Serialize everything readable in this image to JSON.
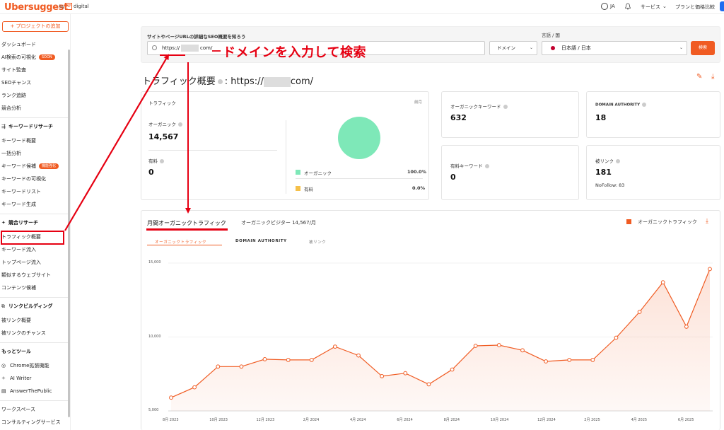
{
  "header": {
    "logo": "Ubersuggest",
    "logo_by": "by",
    "logo_np": "NP",
    "logo_digital": "digital",
    "language": "JA",
    "services": "サービス",
    "pricing": "プランと価格比較"
  },
  "sidebar": {
    "add_project": "+ プロジェクトの追加",
    "group1": [
      {
        "label": "ダッシュボード"
      },
      {
        "label": "AI検索の可視化",
        "badge": "SOON"
      },
      {
        "label": "サイト監査"
      },
      {
        "label": "SEOチャンス"
      },
      {
        "label": "ランク追跡"
      },
      {
        "label": "競合分析"
      }
    ],
    "keyword_research": {
      "heading": "キーワードリサーチ",
      "items": [
        {
          "label": "キーワード概要"
        },
        {
          "label": "一括分析"
        },
        {
          "label": "キーワード候補",
          "badge": "機能強化"
        },
        {
          "label": "キーワードの可視化"
        },
        {
          "label": "キーワードリスト"
        },
        {
          "label": "キーワード生成"
        }
      ]
    },
    "competitive_research": {
      "heading": "競合リサーチ",
      "items": [
        {
          "label": "トラフィック概要"
        },
        {
          "label": "キーワード流入"
        },
        {
          "label": "トップページ流入"
        },
        {
          "label": "類似するウェブサイト"
        },
        {
          "label": "コンテンツ候補"
        }
      ]
    },
    "link_building": {
      "heading": "リンクビルディング",
      "items": [
        {
          "label": "被リンク概要"
        },
        {
          "label": "被リンクのチャンス"
        }
      ]
    },
    "more_tools": {
      "heading": "もっとツール",
      "items": [
        {
          "label": "Chrome拡張機能"
        },
        {
          "label": "AI Writer"
        },
        {
          "label": "AnswerThePublic"
        }
      ]
    },
    "bottom": [
      {
        "label": "ワークスペース"
      },
      {
        "label": "コンサルティングサービス"
      }
    ]
  },
  "search": {
    "label": "サイトやページURLの詳細なSEO概要を知ろう",
    "value_prefix": "https://",
    "value_suffix": "com/",
    "domain_select": "ドメイン",
    "lang_label": "言語 / 国",
    "lang_value": "日本語 / 日本",
    "button": "検索"
  },
  "annotation": {
    "text": "ドメインを入力して検索"
  },
  "overview": {
    "title": "トラフィック概要",
    "title_url_prefix": ": https://",
    "title_url_suffix": "com/"
  },
  "traffic_card": {
    "label": "トラフィック",
    "period": "前月",
    "organic_label": "オーガニック",
    "organic_value": "14,567",
    "paid_label": "有料",
    "paid_value": "0",
    "legend_organic": "オーガニック",
    "legend_organic_pct": "100.0%",
    "legend_paid": "有料",
    "legend_paid_pct": "0.0%",
    "colors": {
      "organic": "#7ee8b8",
      "paid": "#f5c04a"
    }
  },
  "organic_keywords": {
    "label": "オーガニックキーワード",
    "value": "632"
  },
  "domain_authority": {
    "label": "DOMAIN AUTHORITY",
    "value": "18"
  },
  "paid_keywords": {
    "label": "有料キーワード",
    "value": "0"
  },
  "backlinks": {
    "label": "被リンク",
    "value": "181",
    "nofollow": "NoFollow: 83"
  },
  "chart_section": {
    "tab": "月間オーガニックトラフィック",
    "visitors": "オーガニックビジター 14,567/月",
    "legend": "オーガニックトラフィック",
    "subtabs": [
      "オーガニックトラフィック",
      "DOMAIN AUTHORITY",
      "被リンク"
    ]
  },
  "chart_data": {
    "type": "area",
    "x": [
      "2023-08",
      "2023-09",
      "2023-10",
      "2023-11",
      "2023-12",
      "2024-01",
      "2024-02",
      "2024-03",
      "2024-04",
      "2024-05",
      "2024-06",
      "2024-07",
      "2024-08",
      "2024-09",
      "2024-10",
      "2024-11",
      "2024-12",
      "2025-01",
      "2025-02",
      "2025-03",
      "2025-04",
      "2025-05",
      "2025-06",
      "2025-07"
    ],
    "xticks": [
      "8月 2023",
      "10月 2023",
      "12月 2023",
      "2月 2024",
      "4月 2024",
      "6月 2024",
      "8月 2024",
      "10月 2024",
      "12月 2024",
      "2月 2025",
      "4月 2025",
      "6月 2025"
    ],
    "series": [
      {
        "name": "オーガニックトラフィック",
        "values": [
          5900,
          6600,
          8000,
          8000,
          8500,
          8450,
          8450,
          9350,
          8750,
          7350,
          7550,
          6800,
          7800,
          9400,
          9450,
          9100,
          8350,
          8450,
          8450,
          9950,
          11700,
          13700,
          10700,
          14600
        ]
      }
    ],
    "ylim": [
      5000,
      15000
    ],
    "yticks": [
      "15,000",
      "10,000",
      "5,000"
    ],
    "color": "#f05b22"
  }
}
